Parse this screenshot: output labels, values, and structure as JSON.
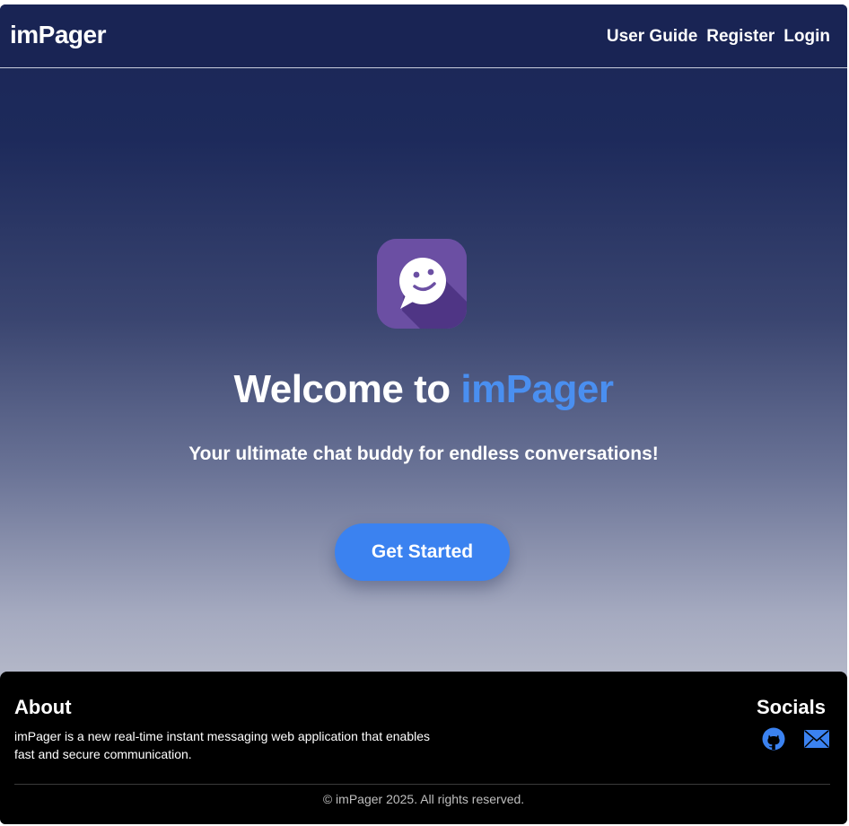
{
  "nav": {
    "brand": "imPager",
    "links": [
      "User Guide",
      "Register",
      "Login"
    ]
  },
  "hero": {
    "app_icon": "chat-bubble-smiley-icon",
    "title_prefix": "Welcome to",
    "title_accent": "imPager",
    "tagline": "Your ultimate chat buddy for endless conversations!",
    "cta_label": "Get Started"
  },
  "footer": {
    "about_title": "About",
    "about_text": "imPager is a new real-time instant messaging web application that enables fast and secure communication.",
    "socials_title": "Socials",
    "socials": [
      "github-icon",
      "mail-icon"
    ],
    "copyright": "© imPager 2025. All rights reserved."
  },
  "colors": {
    "navbar": "#192454",
    "accent": "#4a8ff0",
    "button": "#3b82f0",
    "icon_bg": "#6b4fa3",
    "footer": "#000000"
  }
}
